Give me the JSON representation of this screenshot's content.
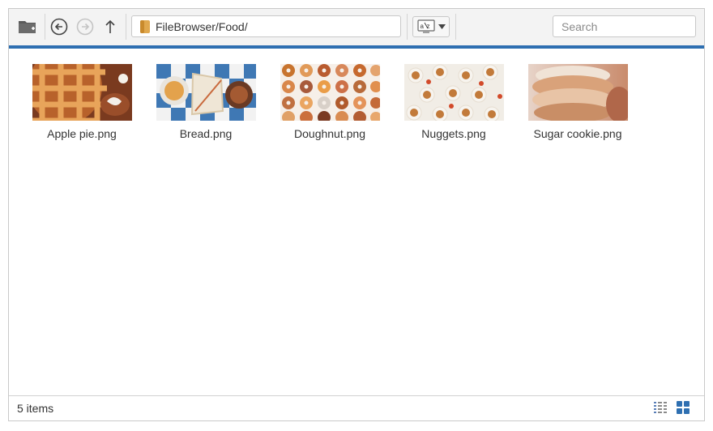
{
  "toolbar": {
    "path": "FileBrowser/Food/",
    "search_placeholder": "Search",
    "icons": [
      "folder-new-icon",
      "back-icon",
      "forward-icon",
      "up-icon",
      "path-folder-icon",
      "sort-az-icon",
      "chevron-down-icon"
    ]
  },
  "files": [
    {
      "name": "Apple pie.png"
    },
    {
      "name": "Bread.png"
    },
    {
      "name": "Doughnut.png"
    },
    {
      "name": "Nuggets.png"
    },
    {
      "name": "Sugar cookie.png"
    }
  ],
  "status": {
    "count_text": "5 items",
    "view_icons": [
      "details-view-icon",
      "tiles-view-icon"
    ]
  },
  "colors": {
    "accent": "#2e6fb1"
  }
}
